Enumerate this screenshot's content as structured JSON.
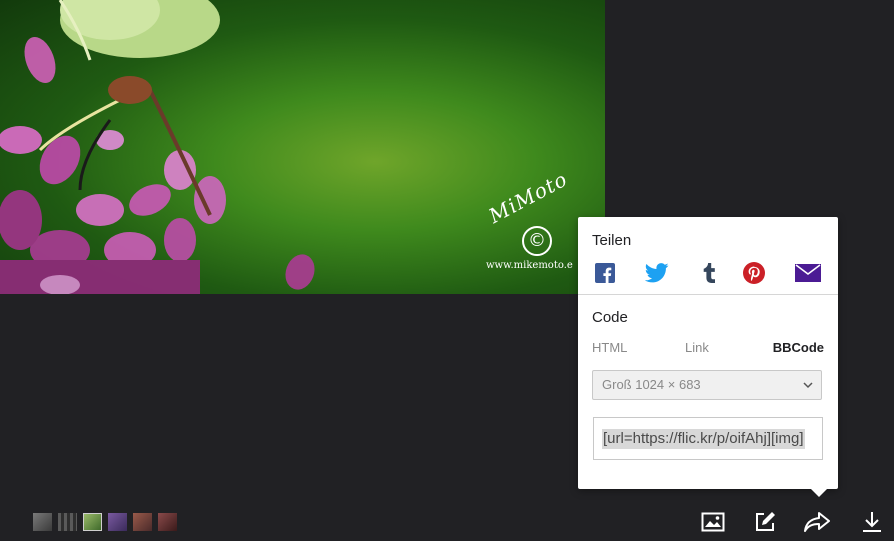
{
  "photo": {
    "watermark_script": "MiMoto",
    "watermark_symbol": "©",
    "watermark_url": "www.mikemoto.e"
  },
  "share_popover": {
    "title": "Teilen",
    "share_targets": [
      {
        "name": "Facebook",
        "icon": "facebook-icon",
        "color": "#3b5998"
      },
      {
        "name": "Twitter",
        "icon": "twitter-icon",
        "color": "#1da1f2"
      },
      {
        "name": "Tumblr",
        "icon": "tumblr-icon",
        "color": "#35465c"
      },
      {
        "name": "Pinterest",
        "icon": "pinterest-icon",
        "color": "#cb2027"
      },
      {
        "name": "Email",
        "icon": "mail-icon",
        "color": "#4b1b94"
      }
    ],
    "code_title": "Code",
    "code_tabs": [
      "HTML",
      "Link",
      "BBCode"
    ],
    "active_tab": "BBCode",
    "size_select": {
      "value": "Groß 1024 × 683"
    },
    "code_value": "[url=https://flic.kr/p/oifAhj][img]"
  },
  "thumbnails": [
    {
      "color": "#5a5a5a"
    },
    {
      "color": "#4a4a4a"
    },
    {
      "color": "#6b8a4a",
      "selected": true
    },
    {
      "color": "#5a4a7a"
    },
    {
      "color": "#7a4a4a"
    },
    {
      "color": "#6a3a3a"
    }
  ],
  "toolbar": {
    "icons": [
      "image-icon",
      "edit-icon",
      "share-icon",
      "download-icon"
    ]
  },
  "colors": {
    "background": "#212124",
    "popover": "#ffffff",
    "text_dark": "#212124",
    "text_muted": "#898989"
  }
}
